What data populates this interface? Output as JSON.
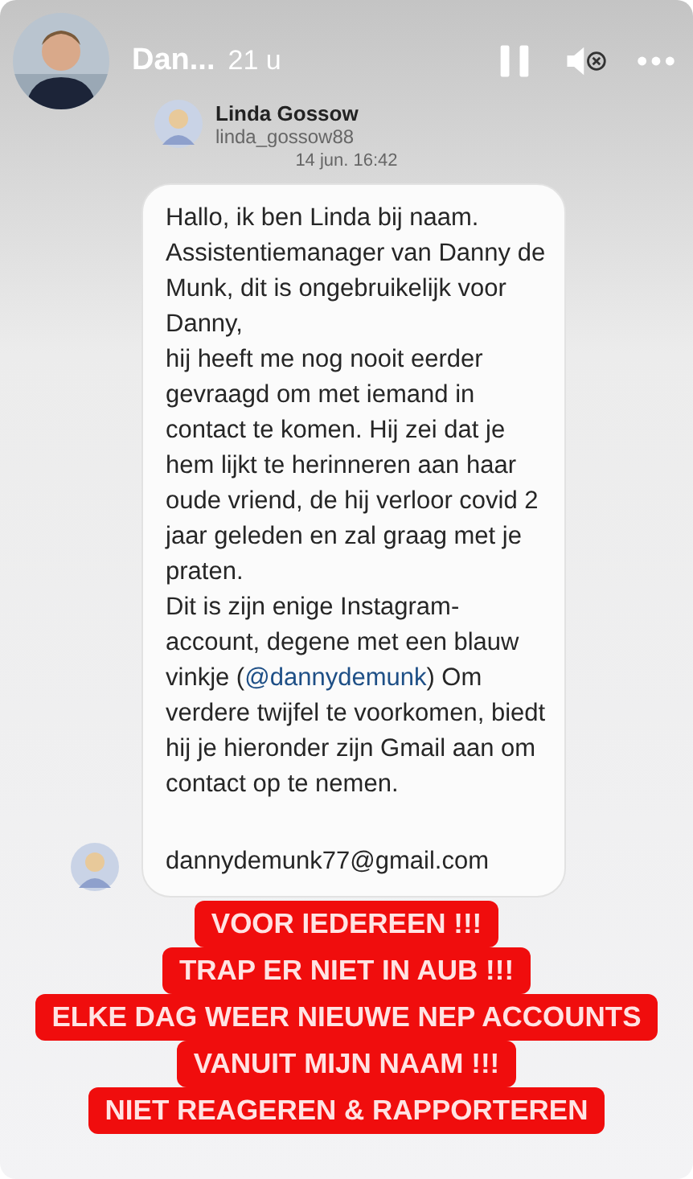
{
  "story": {
    "account": "Dan...",
    "age": "21 u"
  },
  "chat": {
    "sender_name": "Linda Gossow",
    "sender_handle": "linda_gossow88",
    "timestamp": "14 jun. 16:42",
    "paragraphs": [
      [
        {
          "kind": "text",
          "text": "Hallo, ik ben Linda bij naam."
        }
      ],
      [
        {
          "kind": "text",
          "text": "Assistentiemanager van Danny de Munk, dit is ongebruikelijk voor Danny,"
        }
      ],
      [
        {
          "kind": "text",
          "text": "hij heeft me nog nooit eerder gevraagd om met iemand in contact te komen.  Hij zei dat je hem lijkt te herinneren aan haar oude vriend, de hij verloor covid 2 jaar geleden en zal graag met je praten."
        }
      ],
      [
        {
          "kind": "text",
          "text": "Dit is zijn enige Instagram-account, degene met een blauw vinkje ("
        },
        {
          "kind": "mention",
          "text": "@dannydemunk"
        },
        {
          "kind": "text",
          "text": ") Om verdere twijfel te voorkomen, biedt hij je hieronder zijn Gmail aan om contact op te nemen."
        }
      ]
    ],
    "email": "dannydemunk77@gmail.com"
  },
  "banner_lines": [
    "VOOR IEDEREEN !!!",
    "TRAP ER NIET IN AUB !!!",
    "ELKE DAG WEER NIEUWE NEP ACCOUNTS",
    "VANUIT MIJN NAAM !!!",
    "NIET REAGEREN & RAPPORTEREN"
  ]
}
